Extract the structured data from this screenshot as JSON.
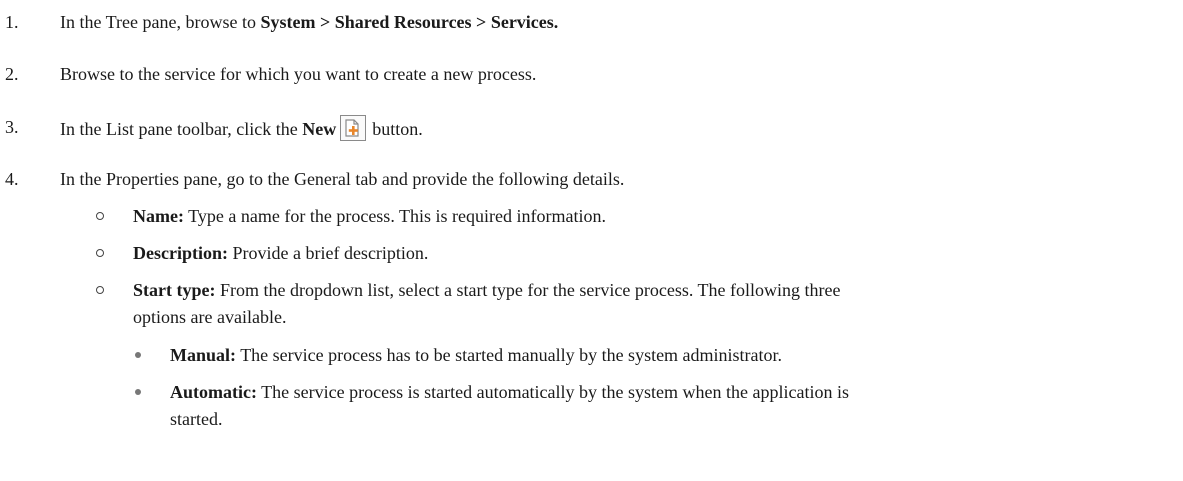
{
  "steps": [
    {
      "num": "1.",
      "pre": "In the Tree pane, browse to ",
      "bold": "System > Shared Resources > Services."
    },
    {
      "num": "2.",
      "text": "Browse to the service for which you want to create a new process."
    },
    {
      "num": "3.",
      "pre": "In the List pane toolbar, click the ",
      "bold": "New",
      "icon": "new-document-icon",
      "post": "button."
    },
    {
      "num": "4.",
      "text": "In the Properties pane, go to the General tab and provide the following details."
    }
  ],
  "details": [
    {
      "label": "Name:",
      "text": " Type a name for the process. This is required information."
    },
    {
      "label": "Description:",
      "text": " Provide a brief description."
    },
    {
      "label": "Start type:",
      "text": " From the dropdown list, select a start type for the service process. The following three",
      "continuation": "options are available."
    }
  ],
  "start_types": [
    {
      "label": "Manual:",
      "text": " The service process has to be started manually by the system administrator."
    },
    {
      "label": "Automatic:",
      "text": " The service process is started automatically by the system when the application is",
      "continuation": "started."
    }
  ],
  "colors": {
    "text": "#1a1a1a",
    "icon_accent": "#e8862a"
  }
}
